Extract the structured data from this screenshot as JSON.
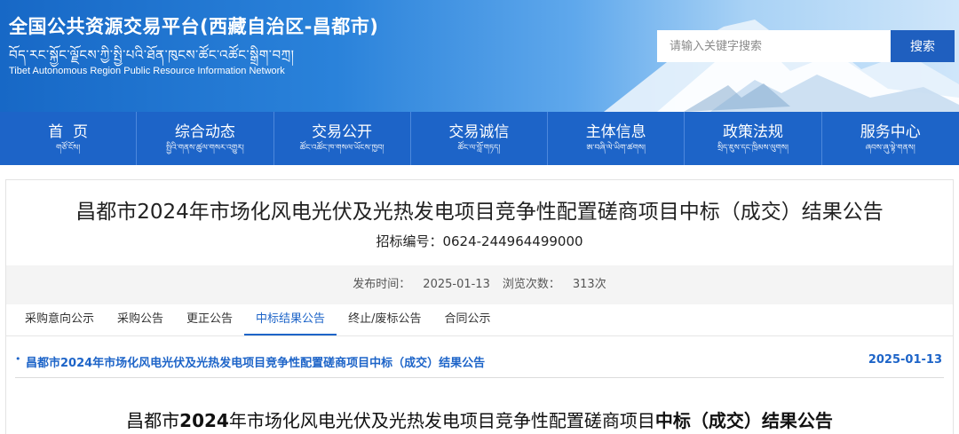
{
  "header": {
    "title": "全国公共资源交易平台(西藏自治区-昌都市)",
    "tibetan": "བོད་རང་སྐྱོང་ལྗོངས་ཀྱི་སྤྱི་པའི་ཐོན་ཁུངས་ཚོང་འཚོང་སྒྲིག་བཀྲ།",
    "english": "Tibet Autonomous Region Public Resource Information Network",
    "search_placeholder": "请输入关键字搜索",
    "search_button": "搜索",
    "colors": {
      "banner": "#2a82da",
      "nav": "#1d64c8",
      "search_button": "#1f5fbf"
    }
  },
  "nav": [
    {
      "label": "首  页",
      "sub": "གཙོ་ངོས།"
    },
    {
      "label": "综合动态",
      "sub": "སྤྱིའི་གནས་ཚུལ་གསར་འགྱུར།"
    },
    {
      "label": "交易公开",
      "sub": "ཚོང་འཚོང་ཁ་གསལ་ཡོངས་ཁྱབ།"
    },
    {
      "label": "交易诚信",
      "sub": "ཚོང་ལ་བློ་གཏད།"
    },
    {
      "label": "主体信息",
      "sub": "ཨ་བཞི་ལེ་ཡིག་ཚགས།"
    },
    {
      "label": "政策法规",
      "sub": "སྲིད་ཇུས་དང་ཁྲིམས་ལུགས།"
    },
    {
      "label": "服务中心",
      "sub": "ཞབས་ཞུ་ལྟེ་གནས།"
    }
  ],
  "article": {
    "title": "昌都市2024年市场化风电光伏及光热发电项目竞争性配置磋商项目中标（成交）结果公告",
    "tender_label": "招标编号：",
    "tender_no": "0624-244964499000",
    "publish_label": "发布时间：",
    "publish_date": "2025-01-13",
    "views_label": "浏览次数：",
    "views": "313次"
  },
  "tabs": [
    {
      "label": "采购意向公示",
      "active": false
    },
    {
      "label": "采购公告",
      "active": false
    },
    {
      "label": "更正公告",
      "active": false
    },
    {
      "label": "中标结果公告",
      "active": true
    },
    {
      "label": "终止/废标公告",
      "active": false
    },
    {
      "label": "合同公示",
      "active": false
    }
  ],
  "doc_list": [
    {
      "bullet": "•",
      "title": "昌都市2024年市场化风电光伏及光热发电项目竞争性配置磋商项目中标（成交）结果公告",
      "date": "2025-01-13"
    }
  ],
  "body": {
    "heading_part1": "昌都市",
    "heading_year": "2024",
    "heading_part2": "年市场化风电光伏及光热发电项目竞争性配置磋商项目",
    "heading_bold": "中标（成交）结果公告"
  }
}
